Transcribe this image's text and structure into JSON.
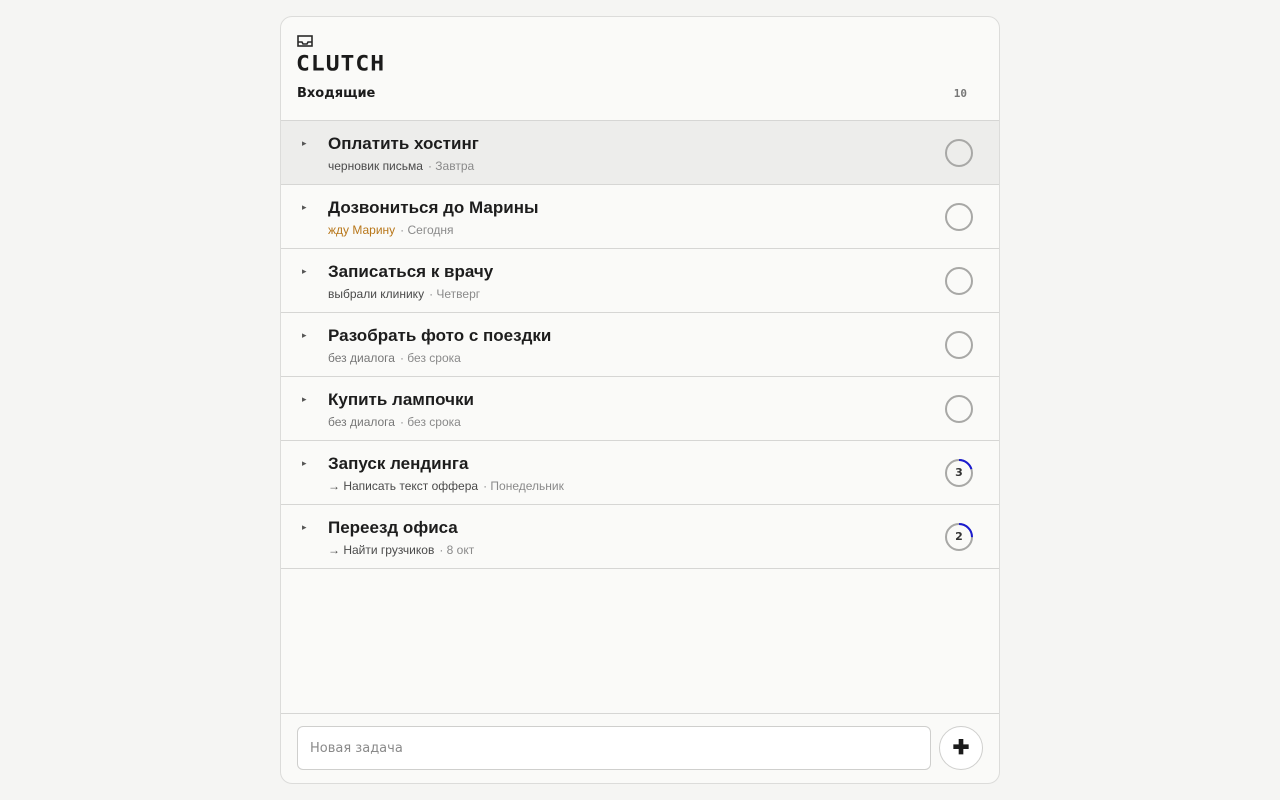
{
  "app": {
    "logo": "CLUTCH"
  },
  "header": {
    "icon": "inbox-icon",
    "section_title": "Входящие",
    "count": "10"
  },
  "tasks": [
    {
      "title": "Оплатить хостинг",
      "note": "черновик письма",
      "note_style": "normal",
      "due": "· Завтра",
      "status": "open",
      "selected": true
    },
    {
      "title": "Дозвониться до Марины",
      "note": "жду Марину",
      "note_style": "waiting",
      "due": "· Сегодня",
      "status": "open",
      "selected": false
    },
    {
      "title": "Записаться к врачу",
      "note": "выбрали клинику",
      "note_style": "normal",
      "due": "· Четверг",
      "status": "open",
      "selected": false
    },
    {
      "title": "Разобрать фото с поездки",
      "note": "без диалога",
      "note_style": "muted",
      "due": "· без срока",
      "status": "open",
      "selected": false
    },
    {
      "title": "Купить лампочки",
      "note": "без диалога",
      "note_style": "muted",
      "due": "· без срока",
      "status": "open",
      "selected": false
    },
    {
      "title": "Запуск лендинга",
      "note": "→ Написать текст оффера",
      "note_style": "normal",
      "due": "· Понедельник",
      "status": "project",
      "count": "3",
      "progress": 0.2,
      "selected": false
    },
    {
      "title": "Переезд офиса",
      "note": "→ Найти грузчиков",
      "note_style": "normal",
      "due": "· 8 окт",
      "status": "project",
      "count": "2",
      "progress": 0.25,
      "selected": false
    }
  ],
  "footer": {
    "input_placeholder": "Новая задача",
    "input_value": "",
    "add_label": "✚"
  },
  "colors": {
    "accent": "#1a1ad0",
    "waiting": "#b8771a",
    "ring": "#a8a8a6"
  }
}
